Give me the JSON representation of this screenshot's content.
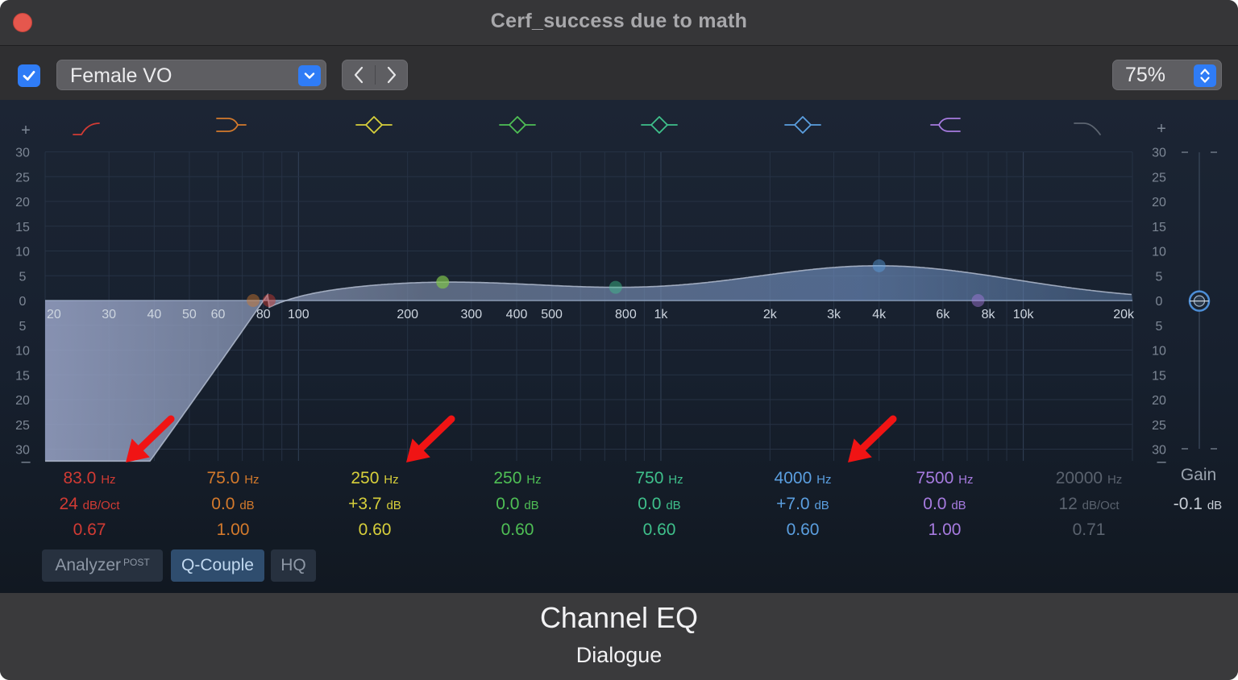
{
  "window": {
    "title": "Cerf_success due to math"
  },
  "toolbar": {
    "bypass_checked": true,
    "preset": "Female VO",
    "zoom": "75%"
  },
  "graph": {
    "db_ticks": [
      "30",
      "25",
      "20",
      "15",
      "10",
      "5",
      "0",
      "5",
      "10",
      "15",
      "20",
      "25",
      "30"
    ],
    "db_values": [
      30,
      25,
      20,
      15,
      10,
      5,
      0,
      -5,
      -10,
      -15,
      -20,
      -25,
      -30
    ],
    "freq_labels": [
      "20",
      "30",
      "40",
      "50",
      "60",
      "80",
      "100",
      "200",
      "300",
      "400",
      "500",
      "800",
      "1k",
      "2k",
      "3k",
      "4k",
      "6k",
      "8k",
      "10k",
      "20k"
    ],
    "freq_values": [
      20,
      30,
      40,
      50,
      60,
      80,
      100,
      200,
      300,
      400,
      500,
      800,
      1000,
      2000,
      3000,
      4000,
      6000,
      8000,
      10000,
      20000
    ],
    "plus_symbol": "+",
    "minus_symbol": "–"
  },
  "bands": [
    {
      "name": "low-cut",
      "shape": "low-cut-icon",
      "color": "#d23b34",
      "freq": "83.0",
      "freq_unit": "Hz",
      "gain": "24",
      "gain_unit": "dB/Oct",
      "q": "0.67",
      "freq_hz": 83.0,
      "gain_db": 0,
      "enabled": true
    },
    {
      "name": "low-shelf",
      "shape": "low-shelf-icon",
      "color": "#d47a2c",
      "freq": "75.0",
      "freq_unit": "Hz",
      "gain": "0.0",
      "gain_unit": "dB",
      "q": "1.00",
      "freq_hz": 75.0,
      "gain_db": 0.0,
      "enabled": true
    },
    {
      "name": "bell-1",
      "shape": "bell-icon",
      "color": "#d7cf3b",
      "freq": "250",
      "freq_unit": "Hz",
      "gain": "+3.7",
      "gain_unit": "dB",
      "q": "0.60",
      "freq_hz": 250,
      "gain_db": 3.7,
      "enabled": true
    },
    {
      "name": "bell-2",
      "shape": "bell-icon",
      "color": "#4fbf55",
      "freq": "250",
      "freq_unit": "Hz",
      "gain": "0.0",
      "gain_unit": "dB",
      "q": "0.60",
      "freq_hz": 250,
      "gain_db": 0.0,
      "enabled": true
    },
    {
      "name": "bell-3",
      "shape": "bell-icon",
      "color": "#3fc08b",
      "freq": "750",
      "freq_unit": "Hz",
      "gain": "0.0",
      "gain_unit": "dB",
      "q": "0.60",
      "freq_hz": 750,
      "gain_db": 0.0,
      "enabled": true
    },
    {
      "name": "bell-4",
      "shape": "bell-icon",
      "color": "#5b9fe0",
      "freq": "4000",
      "freq_unit": "Hz",
      "gain": "+7.0",
      "gain_unit": "dB",
      "q": "0.60",
      "freq_hz": 4000,
      "gain_db": 7.0,
      "enabled": true
    },
    {
      "name": "high-shelf",
      "shape": "high-shelf-icon",
      "color": "#a77be0",
      "freq": "7500",
      "freq_unit": "Hz",
      "gain": "0.0",
      "gain_unit": "dB",
      "q": "1.00",
      "freq_hz": 7500,
      "gain_db": 0.0,
      "enabled": true
    },
    {
      "name": "high-cut",
      "shape": "high-cut-icon",
      "color": "#5d6571",
      "freq": "20000",
      "freq_unit": "Hz",
      "gain": "12",
      "gain_unit": "dB/Oct",
      "q": "0.71",
      "freq_hz": 20000,
      "gain_db": 0,
      "enabled": false
    }
  ],
  "output_gain": {
    "title": "Gain",
    "value": "-0.1",
    "unit": "dB",
    "gain_db": -0.1
  },
  "options": {
    "analyzer": "Analyzer",
    "analyzer_mode": "POST",
    "q_couple": "Q-Couple",
    "q_couple_on": true,
    "hq": "HQ"
  },
  "footer": {
    "plugin_name": "Channel EQ",
    "track_name": "Dialogue"
  },
  "annotations": {
    "arrow_color": "#f01414",
    "arrow_targets": [
      "83.0 Hz",
      "250 Hz",
      "4000 Hz"
    ]
  }
}
